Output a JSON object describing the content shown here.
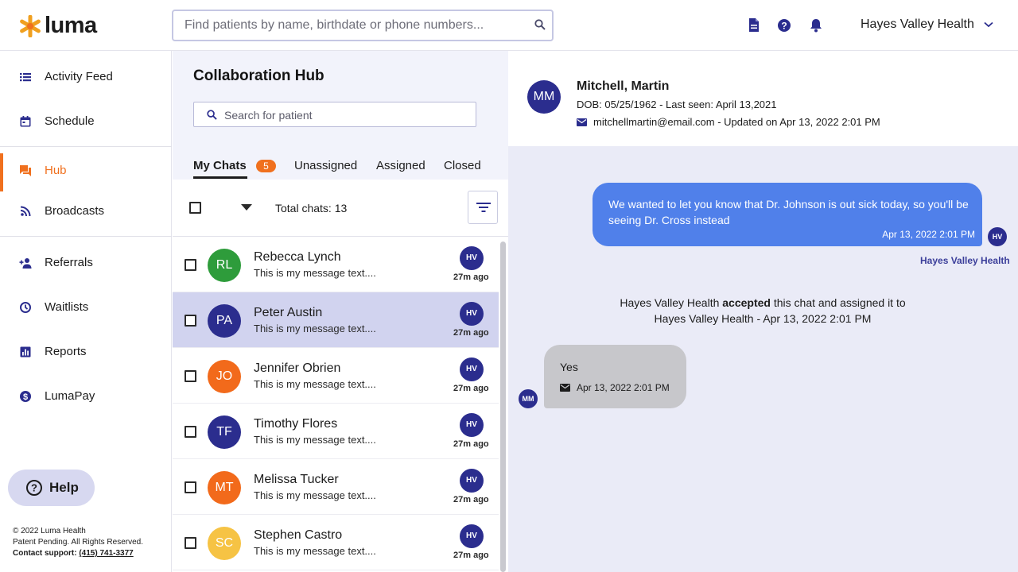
{
  "brand": {
    "name": "luma",
    "accent": "#f0701e",
    "primary": "#2b2d8e"
  },
  "search": {
    "placeholder": "Find patients by name, birthdate or phone numbers..."
  },
  "org": {
    "name": "Hayes Valley Health"
  },
  "nav": {
    "items": [
      {
        "label": "Activity Feed",
        "icon": "list-icon"
      },
      {
        "label": "Schedule",
        "icon": "calendar-icon"
      },
      {
        "label": "Hub",
        "icon": "chat-icon",
        "active": true
      },
      {
        "label": "Broadcasts",
        "icon": "broadcast-icon"
      },
      {
        "label": "Referrals",
        "icon": "add-person-icon"
      },
      {
        "label": "Waitlists",
        "icon": "clock-icon"
      },
      {
        "label": "Reports",
        "icon": "bar-chart-icon"
      },
      {
        "label": "LumaPay",
        "icon": "dollar-icon"
      }
    ],
    "help_label": "Help",
    "footer": {
      "copyright": "© 2022 Luma Health",
      "patent": "Patent Pending. All Rights Reserved.",
      "support_label": "Contact support:",
      "support_phone": "(415) 741-3377"
    }
  },
  "hub": {
    "title": "Collaboration Hub",
    "search_placeholder": "Search for patient",
    "tabs": [
      {
        "label": "My Chats",
        "badge": "5",
        "active": true
      },
      {
        "label": "Unassigned"
      },
      {
        "label": "Assigned"
      },
      {
        "label": "Closed"
      }
    ],
    "total_label": "Total chats: 13",
    "chats": [
      {
        "initials": "RL",
        "name": "Rebecca Lynch",
        "message": "This is my message text....",
        "assignee": "HV",
        "time": "27m ago",
        "color": "#2e9c3b"
      },
      {
        "initials": "PA",
        "name": "Peter Austin",
        "message": "This is my message text....",
        "assignee": "HV",
        "time": "27m ago",
        "color": "#2b2d8e",
        "selected": true
      },
      {
        "initials": "JO",
        "name": "Jennifer Obrien",
        "message": "This is my message text....",
        "assignee": "HV",
        "time": "27m ago",
        "color": "#f26a1b"
      },
      {
        "initials": "TF",
        "name": "Timothy Flores",
        "message": "This is my message text....",
        "assignee": "HV",
        "time": "27m ago",
        "color": "#2b2d8e"
      },
      {
        "initials": "MT",
        "name": "Melissa Tucker",
        "message": "This is my message text....",
        "assignee": "HV",
        "time": "27m ago",
        "color": "#f26a1b"
      },
      {
        "initials": "SC",
        "name": "Stephen Castro",
        "message": "This is my message text....",
        "assignee": "HV",
        "time": "27m ago",
        "color": "#f6c344"
      }
    ]
  },
  "patient": {
    "initials": "MM",
    "name": "Mitchell, Martin",
    "dob_line": "DOB: 05/25/1962 - Last seen: April 13,2021",
    "email_line": "mitchellmartin@email.com - Updated on Apr 13, 2022 2:01 PM"
  },
  "messages": {
    "outgoing": {
      "text": "We wanted to let you know that Dr. Johnson is out sick today, so you'll be seeing Dr. Cross instead",
      "timestamp": "Apr 13, 2022 2:01 PM",
      "avatar": "HV",
      "sender": "Hayes Valley Health"
    },
    "system": {
      "actor": "Hayes Valley Health",
      "verb": "accepted",
      "rest": "this chat and assigned it to Hayes Valley Health - Apr 13, 2022 2:01 PM"
    },
    "incoming": {
      "text": "Yes",
      "timestamp": "Apr 13, 2022 2:01 PM",
      "avatar": "MM"
    }
  }
}
